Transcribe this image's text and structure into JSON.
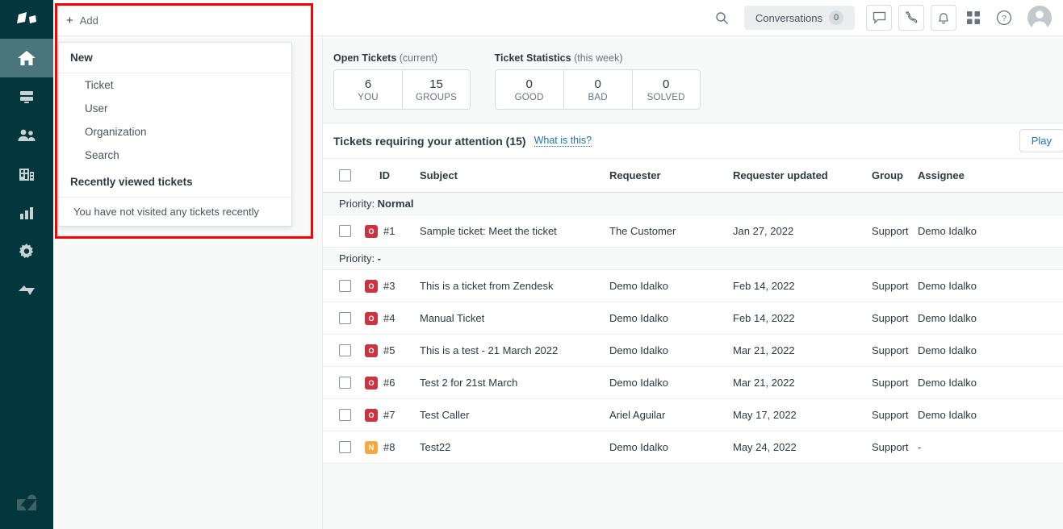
{
  "rail": {
    "items": [
      {
        "name": "zendesk-products-logo",
        "icon": "products-icon"
      },
      {
        "name": "home",
        "icon": "home-icon",
        "active": true
      },
      {
        "name": "views",
        "icon": "views-icon"
      },
      {
        "name": "customers",
        "icon": "people-icon"
      },
      {
        "name": "organizations",
        "icon": "building-icon"
      },
      {
        "name": "reporting",
        "icon": "bar-chart-icon"
      },
      {
        "name": "admin",
        "icon": "gear-icon"
      },
      {
        "name": "explore",
        "icon": "explore-icon"
      }
    ],
    "footer_logo": "zendesk-logo"
  },
  "topbar": {
    "search_icon": "search-icon",
    "conversations_label": "Conversations",
    "conversations_count": "0",
    "chat_icon": "chat-bubble-icon",
    "call_icon": "phone-icon",
    "notifications_icon": "bell-icon",
    "apps_icon": "grid-apps-icon",
    "help_icon": "question-mark-icon",
    "avatar_icon": "user-avatar-icon"
  },
  "add_bar": {
    "plus": "+",
    "label": "Add"
  },
  "dropdown": {
    "new_header": "New",
    "items": [
      "Ticket",
      "User",
      "Organization",
      "Search"
    ],
    "recent_header": "Recently viewed tickets",
    "empty_message": "You have not visited any tickets recently"
  },
  "stats": {
    "open_tickets": {
      "title": "Open Tickets",
      "subtitle": "(current)",
      "boxes": [
        {
          "value": "6",
          "label": "YOU"
        },
        {
          "value": "15",
          "label": "GROUPS"
        }
      ]
    },
    "ticket_statistics": {
      "title": "Ticket Statistics",
      "subtitle": "(this week)",
      "boxes": [
        {
          "value": "0",
          "label": "GOOD"
        },
        {
          "value": "0",
          "label": "BAD"
        },
        {
          "value": "0",
          "label": "SOLVED"
        }
      ]
    }
  },
  "attention": {
    "title": "Tickets requiring your attention (15)",
    "what_is_this": "What is this?",
    "play_label": "Play"
  },
  "table": {
    "headers": {
      "id": "ID",
      "subject": "Subject",
      "requester": "Requester",
      "requester_updated": "Requester updated",
      "group": "Group",
      "assignee": "Assignee"
    },
    "groups": [
      {
        "label_prefix": "Priority: ",
        "label_value": "Normal",
        "rows": [
          {
            "status": "O",
            "status_kind": "open",
            "id": "#1",
            "subject": "Sample ticket: Meet the ticket",
            "requester": "The Customer",
            "updated": "Jan 27, 2022",
            "group": "Support",
            "assignee": "Demo Idalko"
          }
        ]
      },
      {
        "label_prefix": "Priority: ",
        "label_value": "-",
        "rows": [
          {
            "status": "O",
            "status_kind": "open",
            "id": "#3",
            "subject": "This is a ticket from Zendesk",
            "requester": "Demo Idalko",
            "updated": "Feb 14, 2022",
            "group": "Support",
            "assignee": "Demo Idalko"
          },
          {
            "status": "O",
            "status_kind": "open",
            "id": "#4",
            "subject": "Manual Ticket",
            "requester": "Demo Idalko",
            "updated": "Feb 14, 2022",
            "group": "Support",
            "assignee": "Demo Idalko"
          },
          {
            "status": "O",
            "status_kind": "open",
            "id": "#5",
            "subject": "This is a test - 21 March 2022",
            "requester": "Demo Idalko",
            "updated": "Mar 21, 2022",
            "group": "Support",
            "assignee": "Demo Idalko"
          },
          {
            "status": "O",
            "status_kind": "open",
            "id": "#6",
            "subject": "Test 2 for 21st March",
            "requester": "Demo Idalko",
            "updated": "Mar 21, 2022",
            "group": "Support",
            "assignee": "Demo Idalko"
          },
          {
            "status": "O",
            "status_kind": "open",
            "id": "#7",
            "subject": "Test Caller",
            "requester": "Ariel Aguilar",
            "updated": "May 17, 2022",
            "group": "Support",
            "assignee": "Demo Idalko"
          },
          {
            "status": "N",
            "status_kind": "new",
            "id": "#8",
            "subject": "Test22",
            "requester": "Demo Idalko",
            "updated": "May 24, 2022",
            "group": "Support",
            "assignee": "-"
          }
        ]
      }
    ]
  },
  "colors": {
    "rail_bg": "#03363d",
    "rail_active": "#4a757c",
    "status_open": "#cc3340",
    "status_new": "#f5a742",
    "link": "#1f73b7",
    "highlight": "#ff0000"
  }
}
